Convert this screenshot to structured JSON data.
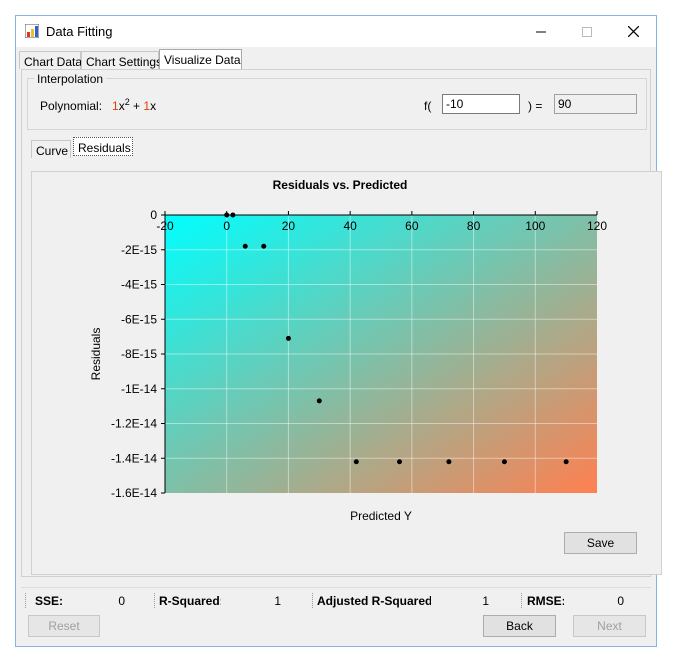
{
  "window": {
    "title": "Data Fitting"
  },
  "tabs": [
    "Chart Data",
    "Chart Settings",
    "Visualize Data"
  ],
  "interpolation": {
    "legend": "Interpolation",
    "polynomial_label": "Polynomial:",
    "poly_c1": "1",
    "poly_x2": "x",
    "poly_exp": "2",
    "poly_plus": "+",
    "poly_c2": "1",
    "poly_x": "x",
    "f_label": "f(",
    "f_input": "-10",
    "eq_label": ") =",
    "result": "90"
  },
  "inner_tabs": [
    "Curve",
    "Residuals"
  ],
  "chart_data": {
    "type": "scatter",
    "title": "Residuals vs. Predicted",
    "xlabel": "Predicted Y",
    "ylabel": "Residuals",
    "xlim": [
      -20,
      120
    ],
    "ylim": [
      -1.6e-14,
      0
    ],
    "x_ticks": [
      "-20",
      "0",
      "20",
      "40",
      "60",
      "80",
      "100",
      "120"
    ],
    "y_ticks": [
      "0",
      "-2E-15",
      "-4E-15",
      "-6E-15",
      "-8E-15",
      "-1E-14",
      "-1.2E-14",
      "-1.4E-14",
      "-1.6E-14"
    ],
    "points": [
      {
        "x": 0,
        "y": 0
      },
      {
        "x": 2,
        "y": 0
      },
      {
        "x": 6,
        "y": -1.8e-15
      },
      {
        "x": 12,
        "y": -1.8e-15
      },
      {
        "x": 20,
        "y": -7.1e-15
      },
      {
        "x": 30,
        "y": -1.07e-14
      },
      {
        "x": 42,
        "y": -1.42e-14
      },
      {
        "x": 56,
        "y": -1.42e-14
      },
      {
        "x": 72,
        "y": -1.42e-14
      },
      {
        "x": 90,
        "y": -1.42e-14
      },
      {
        "x": 110,
        "y": -1.42e-14
      }
    ],
    "gradient": [
      "#00ffff",
      "#ff8050"
    ]
  },
  "buttons": {
    "save": "Save",
    "reset": "Reset",
    "back": "Back",
    "next": "Next"
  },
  "stats": {
    "sse_label": "SSE:",
    "sse": "0",
    "r2_label": "R-Squared:",
    "r2": "1",
    "adj_r2_label": "Adjusted R-Squared:",
    "adj_r2": "1",
    "rmse_label": "RMSE:",
    "rmse": "0"
  }
}
